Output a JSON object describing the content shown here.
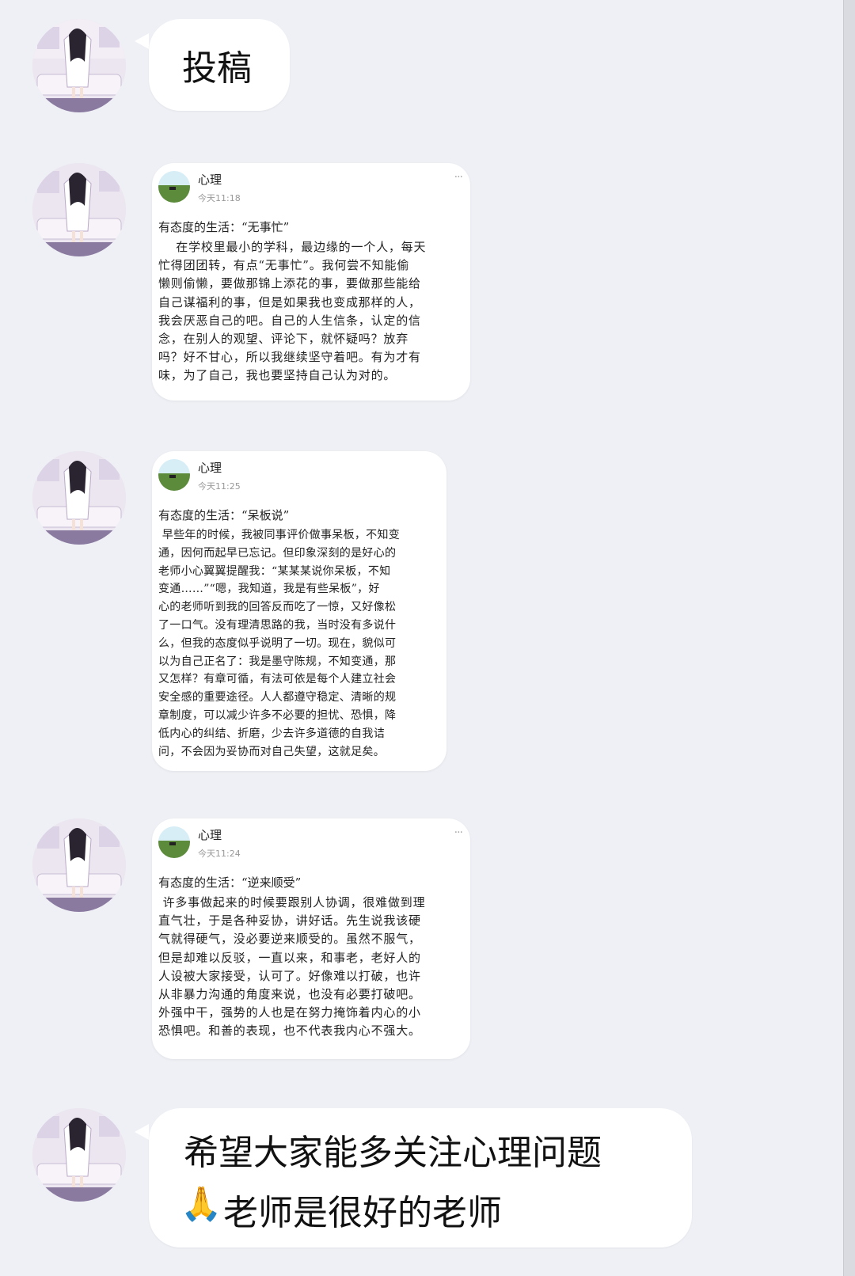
{
  "messages": [
    {
      "type": "text",
      "text": "投稿"
    },
    {
      "type": "post",
      "author": "心理",
      "time": "今天11:18",
      "more": "···",
      "title": "有态度的生活：“无事忙”",
      "body": "    在学校里最小的学科，最边缘的一个人，每天\n忙得团团转，有点“无事忙”。我何尝不知能偷\n懒则偷懒，要做那锦上添花的事，要做那些能给\n自己谋福利的事，但是如果我也变成那样的人，\n我会厌恶自己的吧。自己的人生信条，认定的信\n念，在别人的观望、评论下，就怀疑吗？放弃\n吗？好不甘心，所以我继续坚守着吧。有为才有\n味，为了自己，我也要坚持自己认为对的。"
    },
    {
      "type": "post",
      "author": "心理",
      "time": "今天11:25",
      "more": "",
      "title": "有态度的生活：“呆板说”",
      "body": " 早些年的时候，我被同事评价做事呆板，不知变\n通，因何而起早已忘记。但印象深刻的是好心的\n老师小心翼翼提醒我：“某某某说你呆板，不知\n变通……”“嗯，我知道，我是有些呆板”，好\n心的老师听到我的回答反而吃了一惊，又好像松\n了一口气。没有理清思路的我，当时没有多说什\n么，但我的态度似乎说明了一切。现在，貌似可\n以为自己正名了：我是墨守陈规，不知变通，那\n又怎样？有章可循，有法可依是每个人建立社会\n安全感的重要途径。人人都遵守稳定、清晰的规\n章制度，可以减少许多不必要的担忧、恐惧，降\n低内心的纠结、折磨，少去许多道德的自我诘\n问，不会因为妥协而对自己失望，这就足矣。"
    },
    {
      "type": "post",
      "author": "心理",
      "time": "今天11:24",
      "more": "···",
      "title": "有态度的生活：“逆来顺受”",
      "body": " 许多事做起来的时候要跟别人协调，很难做到理\n直气壮，于是各种妥协，讲好话。先生说我该硬\n气就得硬气，没必要逆来顺受的。虽然不服气，\n但是却难以反驳，一直以来，和事老，老好人的\n人设被大家接受，认可了。好像难以打破，也许\n从非暴力沟通的角度来说，也没有必要打破吧。\n外强中干，强势的人也是在努力掩饰着内心的小\n恐惧吧。和善的表现，也不代表我内心不强大。"
    },
    {
      "type": "text",
      "line1": "希望大家能多关注心理问题",
      "emoji": "🙏",
      "line2": "老师是很好的老师"
    }
  ]
}
